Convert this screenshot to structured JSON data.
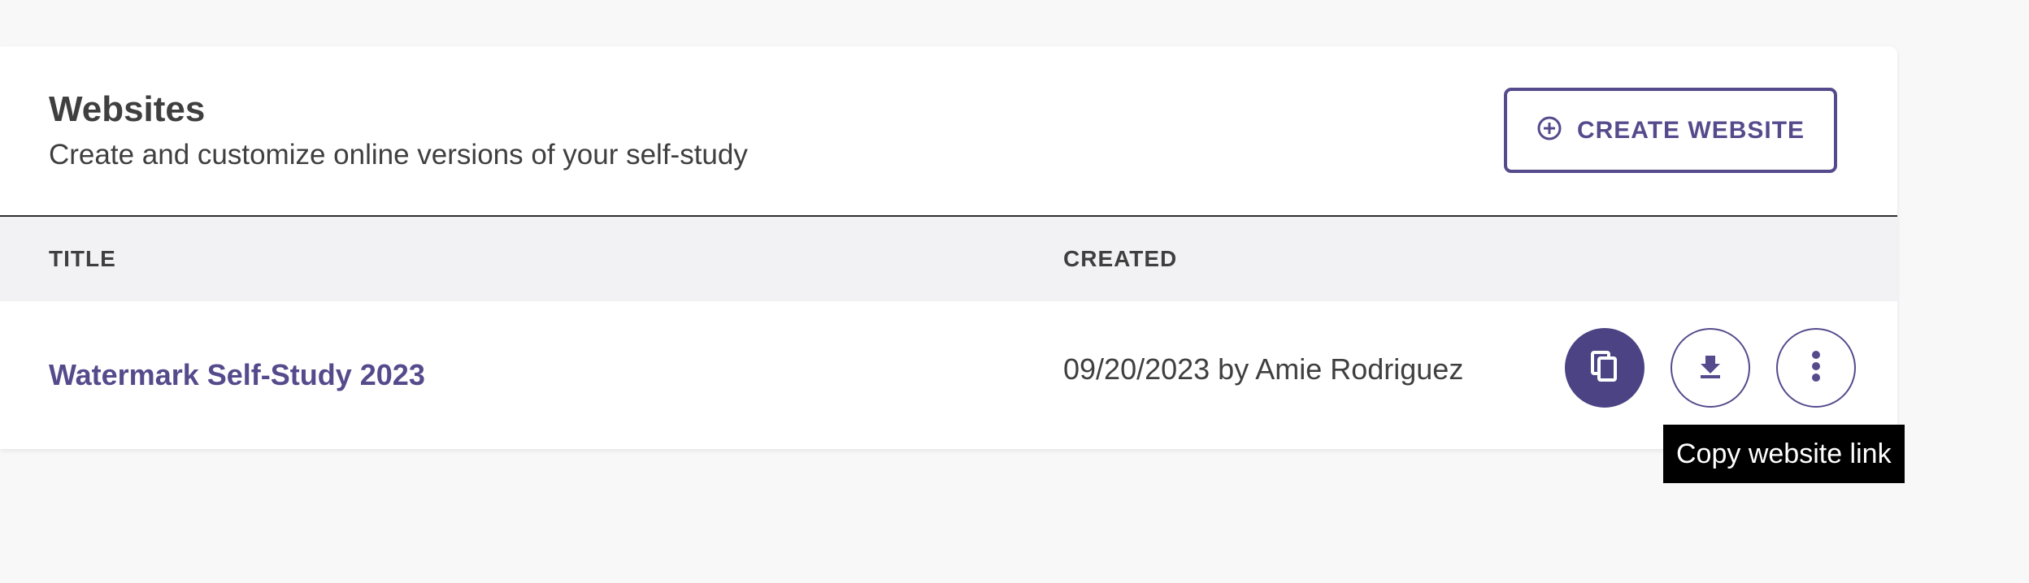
{
  "header": {
    "title": "Websites",
    "subtitle": "Create and customize online versions of your self-study",
    "create_button": {
      "label": "CREATE WEBSITE",
      "icon": "plus-circle-icon"
    }
  },
  "table": {
    "columns": [
      "TITLE",
      "CREATED"
    ],
    "rows": [
      {
        "title": "Watermark Self-Study 2023",
        "created": "09/20/2023 by Amie Rodriguez",
        "actions": [
          {
            "name": "copy-link",
            "icon": "copy-icon"
          },
          {
            "name": "download",
            "icon": "download-icon"
          },
          {
            "name": "more",
            "icon": "more-vertical-icon"
          }
        ]
      }
    ]
  },
  "tooltip": {
    "text": "Copy website link"
  },
  "colors": {
    "accent": "#554b8c",
    "accent_dark": "#4b4384",
    "text": "#3f3f3f",
    "header_bg": "#f2f2f4",
    "page_bg": "#f8f8f8"
  }
}
